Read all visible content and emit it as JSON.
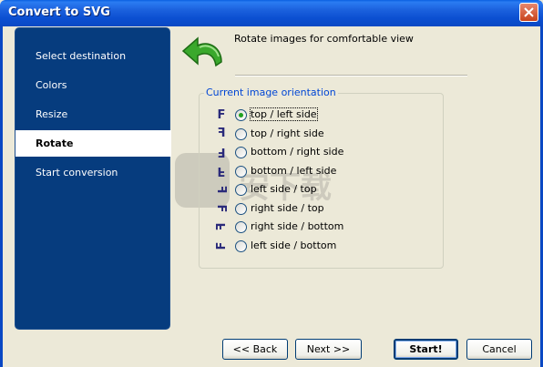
{
  "window": {
    "title": "Convert to SVG",
    "accent": "#0a48c4"
  },
  "sidebar": {
    "bg_color": "#063c7e",
    "items": [
      {
        "label": "Select destination",
        "active": false
      },
      {
        "label": "Colors",
        "active": false
      },
      {
        "label": "Resize",
        "active": false
      },
      {
        "label": "Rotate",
        "active": true
      },
      {
        "label": "Start conversion",
        "active": false
      }
    ]
  },
  "header": {
    "icon": "green-rotate-arrow-icon",
    "text": "Rotate images for comfortable view"
  },
  "orientation": {
    "legend": "Current image orientation",
    "options": [
      {
        "label": "top / left side",
        "glyph": "F",
        "checked": true
      },
      {
        "label": "top / right side",
        "glyph": "ꟻ",
        "checked": false
      },
      {
        "label": "bottom / right side",
        "glyph": "Ⅎ",
        "checked": false
      },
      {
        "label": "bottom / left side",
        "glyph": "Ⅎ",
        "checked": false
      },
      {
        "label": "left side / top",
        "glyph": "ш",
        "checked": false
      },
      {
        "label": "right side / top",
        "glyph": "ш",
        "checked": false
      },
      {
        "label": "right side / bottom",
        "glyph": "ш",
        "checked": false
      },
      {
        "label": "left side / bottom",
        "glyph": "ш",
        "checked": false
      }
    ]
  },
  "watermark": {
    "text": "安下载"
  },
  "buttons": {
    "back": "<< Back",
    "next": "Next >>",
    "start": "Start!",
    "cancel": "Cancel"
  }
}
